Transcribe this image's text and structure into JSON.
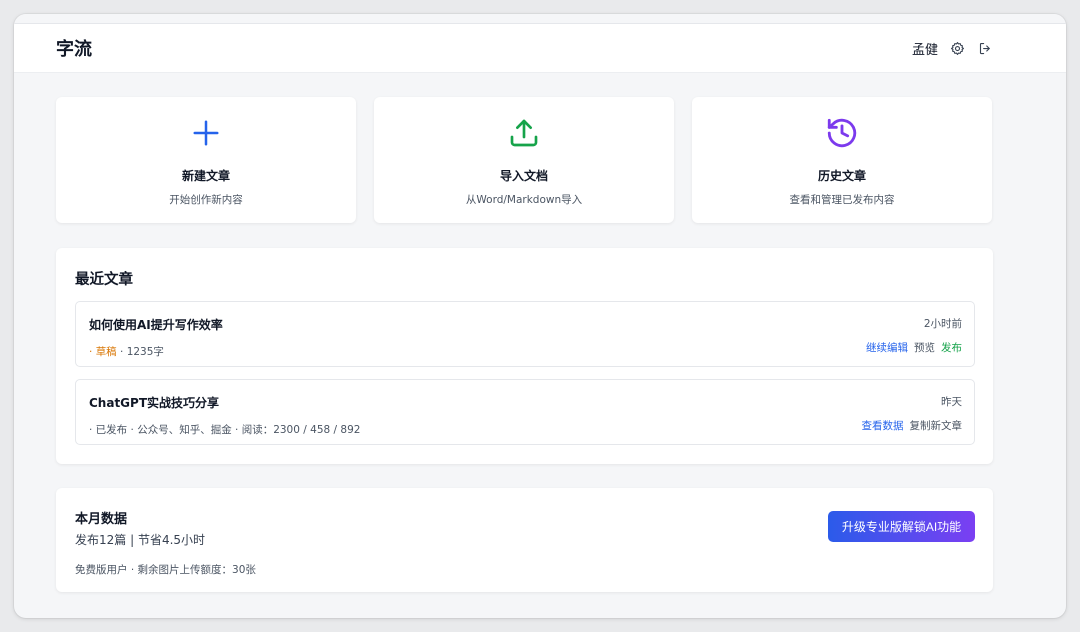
{
  "header": {
    "brand": "字流",
    "username": "孟健"
  },
  "cards": [
    {
      "title": "新建文章",
      "desc": "开始创作新内容",
      "icon": "plus-icon",
      "color": "#2563eb"
    },
    {
      "title": "导入文档",
      "desc": "从Word/Markdown导入",
      "icon": "upload-icon",
      "color": "#16a34a"
    },
    {
      "title": "历史文章",
      "desc": "查看和管理已发布内容",
      "icon": "history-icon",
      "color": "#7c3aed"
    }
  ],
  "recent": {
    "title": "最近文章",
    "articles": [
      {
        "title": "如何使用AI提升写作效率",
        "time": "2小时前",
        "meta_prefix": "· ",
        "meta_status": "草稿",
        "meta_rest": " · 1235字",
        "actions": [
          "继续编辑",
          "预览",
          "发布"
        ]
      },
      {
        "title": "ChatGPT实战技巧分享",
        "time": "昨天",
        "meta": "· 已发布 · 公众号、知乎、掘金 · 阅读：2300 / 458 / 892",
        "actions": [
          "查看数据",
          "复制新文章"
        ]
      }
    ]
  },
  "month": {
    "title": "本月数据",
    "summary": "发布12篇 | 节省4.5小时",
    "quota": "免费版用户 · 剩余图片上传额度：30张",
    "upgrade_label": "升级专业版解锁AI功能"
  },
  "colors": {
    "accent_blue": "#2563eb",
    "accent_green": "#16a34a",
    "accent_purple": "#7c3aed",
    "draft_orange": "#d97706"
  }
}
